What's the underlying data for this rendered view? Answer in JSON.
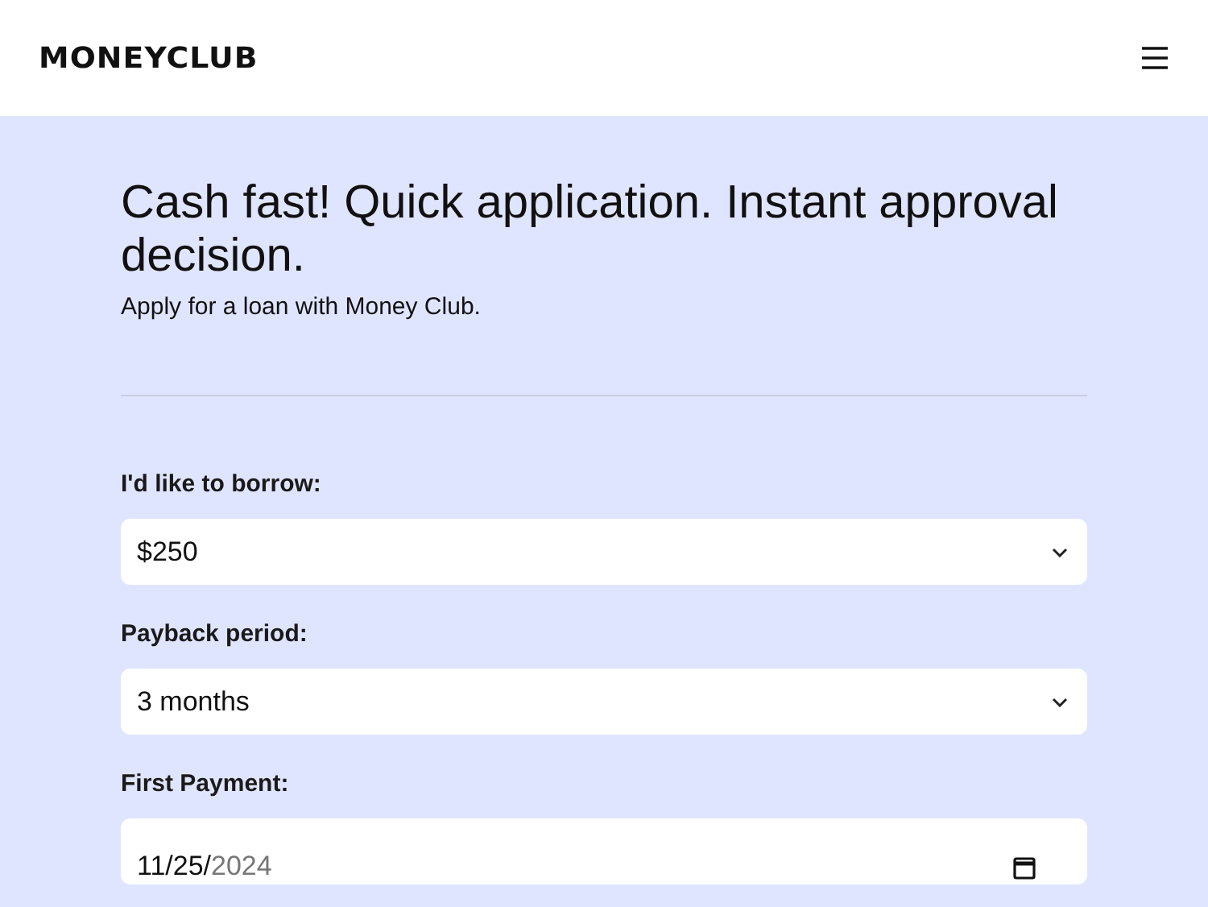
{
  "header": {
    "logo": "MONEYCLUB"
  },
  "hero": {
    "title": "Cash fast! Quick application. Instant approval decision.",
    "subtitle": "Apply for a loan with Money Club."
  },
  "form": {
    "fields": [
      {
        "kind": "select",
        "label": "I'd like to borrow:",
        "value": "$250"
      },
      {
        "kind": "select",
        "label": "Payback period:",
        "value": "3 months"
      },
      {
        "kind": "date",
        "label": "First Payment:",
        "value": "11/25/",
        "pending": "2024"
      }
    ]
  }
}
